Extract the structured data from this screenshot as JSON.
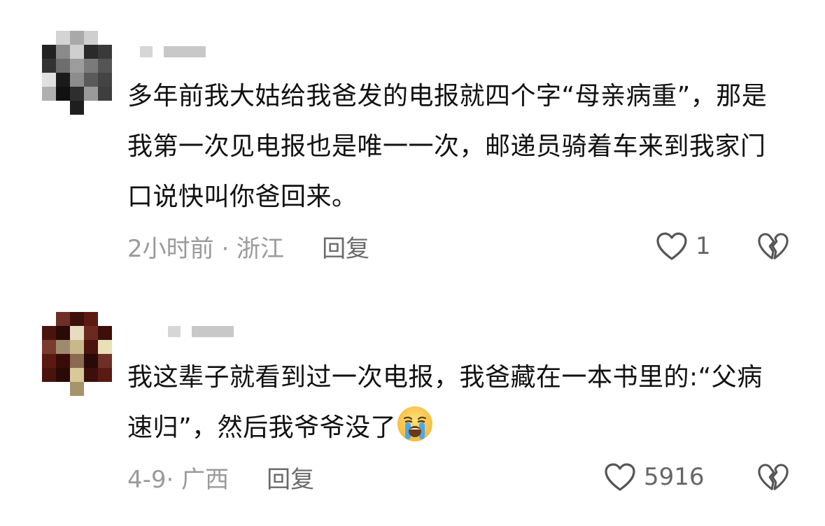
{
  "comments": [
    {
      "text": "多年前我大姑给我爸发的电报就四个字“母亲病重”，那是我第一次见电报也是唯一一次，邮递员骑着车来到我家门口说快叫你爸回来。",
      "meta": "2小时前 · 浙江",
      "reply_label": "回复",
      "like_count": "1",
      "avatar_colors": [
        "#3a3a3a",
        "#7a7a7a",
        "#2a2a2a",
        "#9a9a9a",
        "#1e1e1e",
        "#c8c8c8",
        "#555555",
        "#111111"
      ]
    },
    {
      "text": "我这辈子就看到过一次电报，我爸藏在一本书里的:“父病 速归”，然后我爷爷没了",
      "emoji": "crying-face-emoji",
      "meta": "4-9· 广西",
      "reply_label": "回复",
      "like_count": "5916",
      "avatar_colors": [
        "#5a1a12",
        "#3d0f0a",
        "#e8dcc0",
        "#8a6a50",
        "#2a0a06",
        "#c9b98a",
        "#6e2f26",
        "#a08a6e"
      ]
    }
  ],
  "icons": {
    "like": "heart-outline-icon",
    "dislike": "broken-heart-icon"
  }
}
